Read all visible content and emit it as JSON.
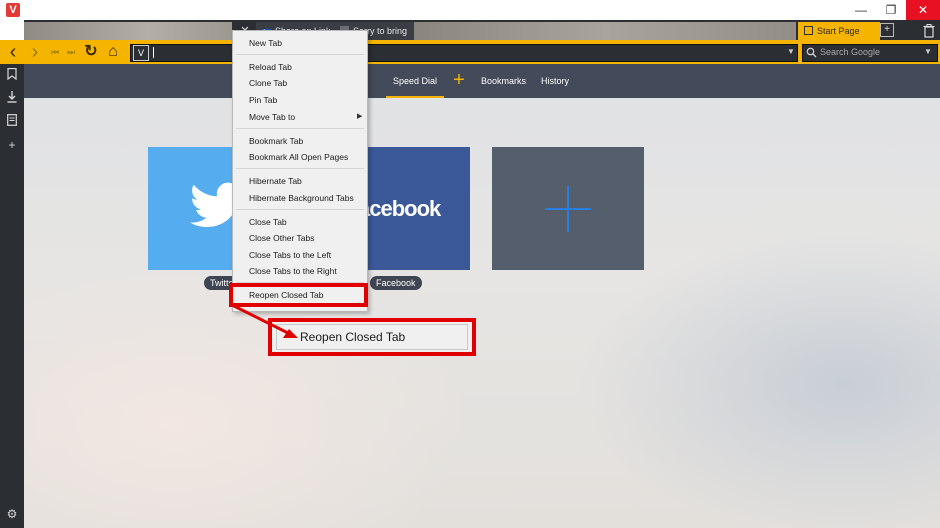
{
  "window": {
    "logo": "V",
    "minimize_glyph": "—",
    "restore_glyph": "❐",
    "close_glyph": "✕"
  },
  "tabs": {
    "close_glyph": "✕",
    "linkedin": {
      "icon": "in",
      "label": "Share on Link"
    },
    "sorry": {
      "label": "Sorry to bring"
    },
    "start_page": {
      "label": "Start Page"
    },
    "new_tab_glyph": "+",
    "trash_icon": "trash-icon"
  },
  "address_bar": {
    "back_glyph": "‹",
    "forward_glyph": "›",
    "rewind_glyph": "⏮",
    "fastforward_glyph": "⏭",
    "reload_glyph": "↻",
    "home_glyph": "⌂",
    "url_badge": "V",
    "url_value": "",
    "dropdown_glyph": "▼",
    "search_placeholder": "Search Google",
    "search_icon_glyph": "🔍︎"
  },
  "sidebar": {
    "items": [
      {
        "icon": "bookmark-icon",
        "glyph": "⛉"
      },
      {
        "icon": "download-icon",
        "glyph": "⤓"
      },
      {
        "icon": "notes-icon",
        "glyph": "▤"
      },
      {
        "icon": "add-panel-icon",
        "glyph": "+"
      }
    ],
    "settings_glyph": "⚙"
  },
  "speed_dial_nav": {
    "speed_dial": "Speed Dial",
    "add_glyph": "+",
    "bookmarks": "Bookmarks",
    "history": "History"
  },
  "dials": {
    "twitter": {
      "label": "Twitter"
    },
    "facebook": {
      "logo_text": "acebook",
      "label": "Facebook"
    }
  },
  "context_menu": {
    "items": [
      "New Tab",
      "Reload Tab",
      "Clone Tab",
      "Pin Tab",
      "Move Tab to",
      "Bookmark Tab",
      "Bookmark All Open Pages",
      "Hibernate Tab",
      "Hibernate Background Tabs",
      "Close Tab",
      "Close Other Tabs",
      "Close Tabs to the Left",
      "Close Tabs to the Right",
      "Reopen Closed Tab"
    ],
    "submenu_arrow": "▶"
  },
  "callout": {
    "label": "Reopen Closed Tab"
  },
  "colors": {
    "accent": "#f5b400",
    "chrome_dark": "#2b2e33",
    "highlight_red": "#e00000",
    "twitter_blue": "#55acee",
    "facebook_blue": "#3b5998"
  }
}
